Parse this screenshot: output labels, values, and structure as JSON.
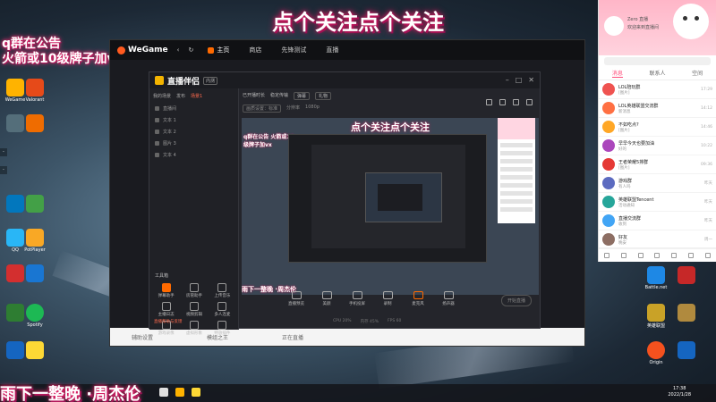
{
  "overlay": {
    "banner": "点个关注点个关注",
    "notice_line1": "q群在公告",
    "notice_line2": "火箭或10级牌子加vx",
    "bottom_text": "雨下一整晚 ·周杰伦"
  },
  "desktop_icons": [
    {
      "label": "WeGame",
      "color": "#ffb300"
    },
    {
      "label": "Valorant",
      "color": "#e64a19"
    },
    {
      "label": "QQ",
      "color": "#29b6f6"
    },
    {
      "label": "PotPlayer",
      "color": "#f9a825"
    },
    {
      "label": "Spotify",
      "color": "#1db954"
    },
    {
      "label": "bilibili",
      "color": "#fb7299"
    }
  ],
  "wegame": {
    "logo": "WeGame",
    "tabs": [
      "主页",
      "商店",
      "先锋测试",
      "直播"
    ],
    "bottom_items": [
      "辅助设置",
      "模组之王",
      "正在直播"
    ]
  },
  "tool": {
    "name": "直播伴侣",
    "badge": "内测",
    "scene_tabs": [
      "我的场景",
      "发布",
      "场景1"
    ],
    "sources": [
      "直播间",
      "文本 1",
      "文本 2",
      "图片 3",
      "文本 4"
    ],
    "toolbox_title": "工具箱",
    "tools": [
      "弹幕助手",
      "房管助手",
      "上传音乐",
      "主播日志",
      "视频剪辑",
      "多人连麦",
      "游戏录像",
      "虚拟形象",
      "特效插件"
    ],
    "top_info": [
      "已开播时长",
      "稳定传输",
      "弹幕",
      "礼物"
    ],
    "top_info2": [
      "画质设置：标准",
      "分辨率",
      "1080p"
    ],
    "controls": [
      "直播预览",
      "美颜",
      "手机投屏",
      "录制",
      "麦克风",
      "扬声器"
    ],
    "start_button": "开始直播",
    "status": [
      "CPU 20%",
      "内存 45%",
      "FPS 60"
    ],
    "help_link": "直播帮助与反馈"
  },
  "preview": {
    "banner": "点个关注点个关注",
    "notice": "q群在公告 火箭或10级牌子加vx",
    "bottom": "雨下一整晚 ·周杰伦"
  },
  "chat": {
    "name": "Zero 直播",
    "subtitle": "欢迎来到直播间",
    "tabs": [
      "消息",
      "联系人",
      "空间"
    ],
    "messages": [
      {
        "title": "LOL陪玩群",
        "text": "[图片]",
        "time": "17:29",
        "color": "#ef5350"
      },
      {
        "title": "LOL英雄联盟交流群",
        "text": "新消息",
        "time": "14:12",
        "color": "#ff7043"
      },
      {
        "title": "不如吃点?",
        "text": "[图片]",
        "time": "14:46",
        "color": "#ffa726"
      },
      {
        "title": "早早今天也要加油",
        "text": "好的",
        "time": "10:22",
        "color": "#ab47bc"
      },
      {
        "title": "王者荣耀5排群",
        "text": "[图片]",
        "time": "09:36",
        "color": "#e53935"
      },
      {
        "title": "游戏群",
        "text": "有人吗",
        "time": "昨天",
        "color": "#5c6bc0"
      },
      {
        "title": "英雄联盟Tencent",
        "text": "活动通知",
        "time": "昨天",
        "color": "#26a69a"
      },
      {
        "title": "直播交流群",
        "text": "收到",
        "time": "昨天",
        "color": "#42a5f5"
      },
      {
        "title": "好友",
        "text": "晚安",
        "time": "周一",
        "color": "#8d6e63"
      }
    ]
  },
  "taskbar": {
    "time": "17:38",
    "date": "2022/1/28"
  },
  "right_desktop_icons": [
    {
      "label": "Battle.net",
      "color": "#1e88e5"
    },
    {
      "label": "Steam",
      "color": "#37474f"
    },
    {
      "label": "英雄联盟",
      "color": "#c9a227"
    },
    {
      "label": "Origin",
      "color": "#f4511e"
    }
  ]
}
